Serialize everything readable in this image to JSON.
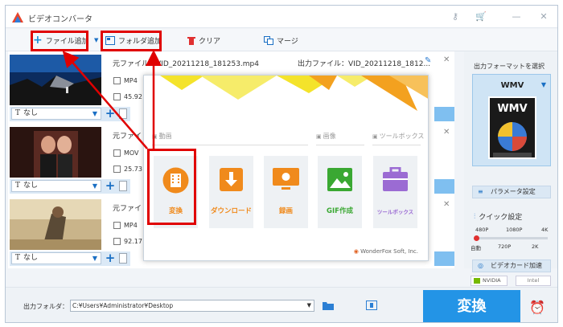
{
  "window": {
    "title": "ビデオコンバータ"
  },
  "toolbar": {
    "add_file": "ファイル追加",
    "add_folder": "フォルダ追加",
    "clear": "クリア",
    "merge": "マージ"
  },
  "files": [
    {
      "source_label": "元ファイル：",
      "source_name": "VID_20211218_181253.mp4",
      "format": "MP4",
      "size": "45.92",
      "output_label": "出力ファイル：",
      "output_name": "VID_20211218_1812...",
      "subtitle": "なし"
    },
    {
      "source_label": "元ファイ",
      "format": "MOV",
      "size": "25.73",
      "subtitle": "なし"
    },
    {
      "source_label": "元ファイ",
      "format": "MP4",
      "size": "92.17",
      "subtitle": "なし"
    }
  ],
  "dialog": {
    "sections": {
      "video": "動画",
      "image": "画像",
      "toolbox": "ツールボックス"
    },
    "cards": [
      {
        "label": "変換",
        "color": "#f08a1c"
      },
      {
        "label": "ダウンロード",
        "color": "#f08a1c"
      },
      {
        "label": "録画",
        "color": "#f08a1c"
      },
      {
        "label": "GIF作成",
        "color": "#3aa832"
      },
      {
        "label": "ツールボックス",
        "color": "#9b6bd3"
      }
    ],
    "footer": "WonderFox Soft, Inc."
  },
  "right_panel": {
    "title": "出力フォーマットを選択",
    "format": "WMV",
    "format_icon_text": "WMV",
    "param_button": "パラメータ設定",
    "quick_setting": "クイック設定",
    "quality_top": [
      "480P",
      "1080P",
      "4K"
    ],
    "quality_bottom": [
      "自動",
      "720P",
      "2K"
    ],
    "gpu_button": "ビデオカード加速",
    "gpu_vendors": [
      "NVIDIA",
      "Intel"
    ]
  },
  "bottom": {
    "output_folder_label": "出力フォルダ：",
    "output_folder_path": "C:¥Users¥Administrator¥Desktop",
    "convert_button": "変換"
  },
  "colors": {
    "accent_blue": "#2394e6",
    "highlight_red": "#e00000",
    "orange": "#f08a1c"
  }
}
